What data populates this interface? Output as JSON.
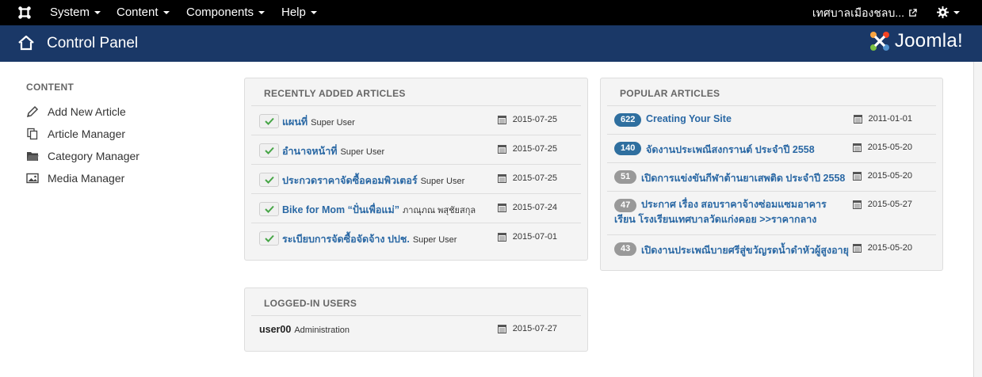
{
  "navbar": {
    "menus": [
      "System",
      "Content",
      "Components",
      "Help"
    ],
    "site_name": "เทศบาลเมืองชลบ...",
    "icons": {
      "logo": "joomla-icon",
      "external": "external-link-icon",
      "settings": "gear-icon"
    }
  },
  "header": {
    "title": "Control Panel",
    "brand": "Joomla!",
    "brand_colors": [
      "#f9a541",
      "#f44321",
      "#5091cd",
      "#7ac143"
    ]
  },
  "sidebar": {
    "heading": "CONTENT",
    "items": [
      {
        "label": "Add New Article",
        "icon": "pencil-icon"
      },
      {
        "label": "Article Manager",
        "icon": "copy-icon"
      },
      {
        "label": "Category Manager",
        "icon": "folder-icon"
      },
      {
        "label": "Media Manager",
        "icon": "image-icon"
      }
    ]
  },
  "recent": {
    "heading": "RECENTLY ADDED ARTICLES",
    "items": [
      {
        "title": "แผนที่",
        "author": "Super User",
        "date": "2015-07-25"
      },
      {
        "title": "อำนาจหน้าที่",
        "author": "Super User",
        "date": "2015-07-25"
      },
      {
        "title": "ประกวดราคาจัดซื้อคอมพิวเตอร์",
        "author": "Super User",
        "date": "2015-07-25"
      },
      {
        "title": "Bike for Mom “ปั่นเพื่อแม่”",
        "author": "ภาณุภณ พสุชัยสกุล",
        "date": "2015-07-24"
      },
      {
        "title": "ระเบียบการจัดซื้อจัดจ้าง ปปช.",
        "author": "Super User",
        "date": "2015-07-01"
      }
    ]
  },
  "popular": {
    "heading": "POPULAR ARTICLES",
    "items": [
      {
        "hits": "622",
        "title": "Creating Your Site",
        "date": "2011-01-01"
      },
      {
        "hits": "140",
        "title": "จัดงานประเพณีสงกรานต์ ประจำปี 2558",
        "date": "2015-05-20"
      },
      {
        "hits": "51",
        "title": "เปิดการแข่งขันกีฬาต้านยาเสพติด ประจำปี 2558",
        "date": "2015-05-20"
      },
      {
        "hits": "47",
        "title": "ประกาศ เรื่อง สอบราคาจ้างซ่อมแซมอาคารเรียน โรงเรียนเทศบาลวัดแก่งคอย >>ราคากลาง",
        "date": "2015-05-27"
      },
      {
        "hits": "43",
        "title": "เปิดงานประเพณีบายศรีสู่ขวัญรดน้ำดำหัวผู้สูงอายุ",
        "date": "2015-05-20"
      }
    ],
    "badge_colors": {
      "high": "#2f6f9f",
      "low": "#999999"
    }
  },
  "users": {
    "heading": "LOGGED-IN USERS",
    "items": [
      {
        "name": "user00",
        "role": "Administration",
        "date": "2015-07-27"
      }
    ]
  }
}
